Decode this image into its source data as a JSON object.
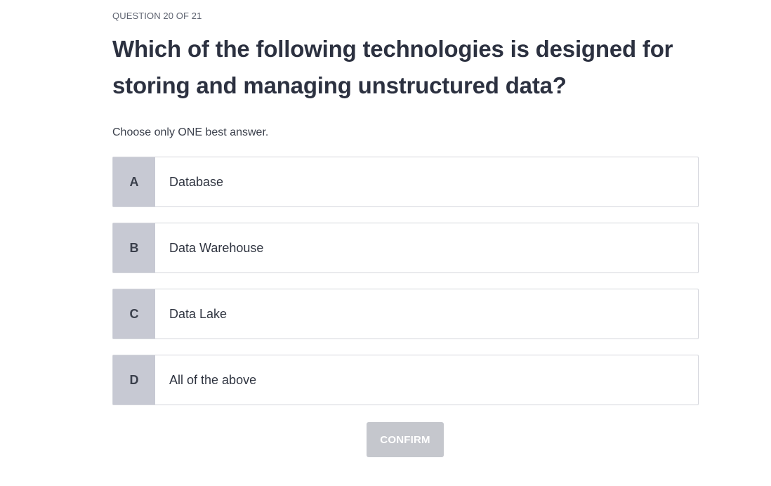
{
  "quiz": {
    "progress": "QUESTION 20 OF 21",
    "question": "Which of the following technologies is designed for storing and managing unstructured data?",
    "instruction": "Choose only ONE best answer.",
    "options": [
      {
        "letter": "A",
        "text": "Database"
      },
      {
        "letter": "B",
        "text": "Data Warehouse"
      },
      {
        "letter": "C",
        "text": "Data Lake"
      },
      {
        "letter": "D",
        "text": "All of the above"
      }
    ],
    "confirm_label": "CONFIRM",
    "confirm_enabled": false
  },
  "colors": {
    "letter_bg": "#c7c9d3",
    "confirm_disabled_bg": "#c5c7cd",
    "text": "#2f3440",
    "border": "#d4d6dc"
  }
}
